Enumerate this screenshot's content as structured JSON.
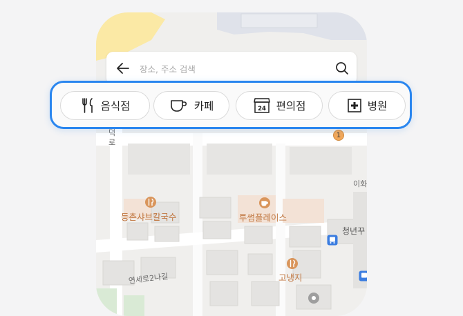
{
  "search": {
    "placeholder": "장소, 주소 검색"
  },
  "categories": [
    {
      "label": "음식점",
      "icon": "fork-knife-icon"
    },
    {
      "label": "카페",
      "icon": "coffee-cup-icon"
    },
    {
      "label": "편의점",
      "icon": "store-24-icon"
    },
    {
      "label": "병원",
      "icon": "hospital-cross-icon"
    }
  ],
  "map": {
    "pois": [
      {
        "label": "등촌샤브칼국수",
        "icon": "restaurant-pin-icon"
      },
      {
        "label": "투썸플레이스",
        "icon": "cafe-pin-icon"
      },
      {
        "label": "고냉지",
        "icon": "restaurant-pin-icon"
      }
    ],
    "street_labels": [
      "연세로2나길",
      "청년꾸",
      "이화",
      "로",
      "덕"
    ],
    "badges": [
      {
        "label": "1"
      }
    ]
  },
  "colors": {
    "accent": "#2a86ef",
    "poi": "#c0763f",
    "poi_pin": "#d9955b",
    "bus_stop": "#3b7de0",
    "park": "#fbe9a5",
    "water": "#dfe2ea"
  }
}
